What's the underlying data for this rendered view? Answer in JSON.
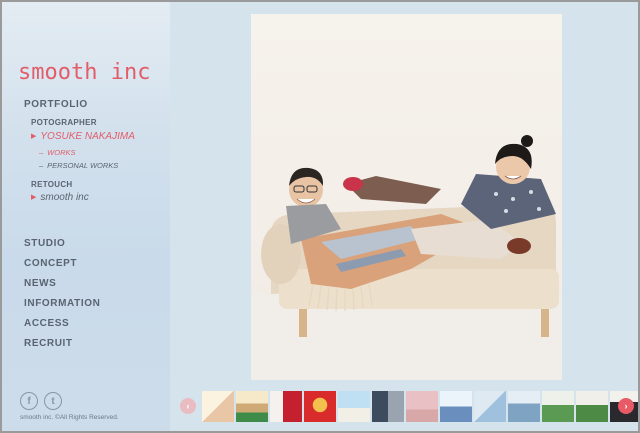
{
  "brand": {
    "logo": "smooth inc"
  },
  "nav": {
    "portfolio": "PORTFOLIO",
    "potographer": "POTOGRAPHER",
    "photographer_name": "YOSUKE NAKAJIMA",
    "works": "WORKS",
    "personal_works": "PERSONAL WORKS",
    "retouch": "RETOUCH",
    "retouch_name": "smooth inc",
    "studio": "STUDIO",
    "concept": "CONCEPT",
    "news": "NEWS",
    "information": "INFORMATION",
    "access": "ACCESS",
    "recruit": "RECRUIT"
  },
  "social": {
    "facebook": "f",
    "twitter": "t"
  },
  "footer": {
    "copyright": "smooth inc. ©All Rights Reserved."
  },
  "colors": {
    "accent": "#e25d6a",
    "nav_text": "#5a6470",
    "background": "#d4e3ec"
  },
  "gallery": {
    "prev_icon": "‹",
    "next_icon": "›",
    "thumbnails": 13
  }
}
